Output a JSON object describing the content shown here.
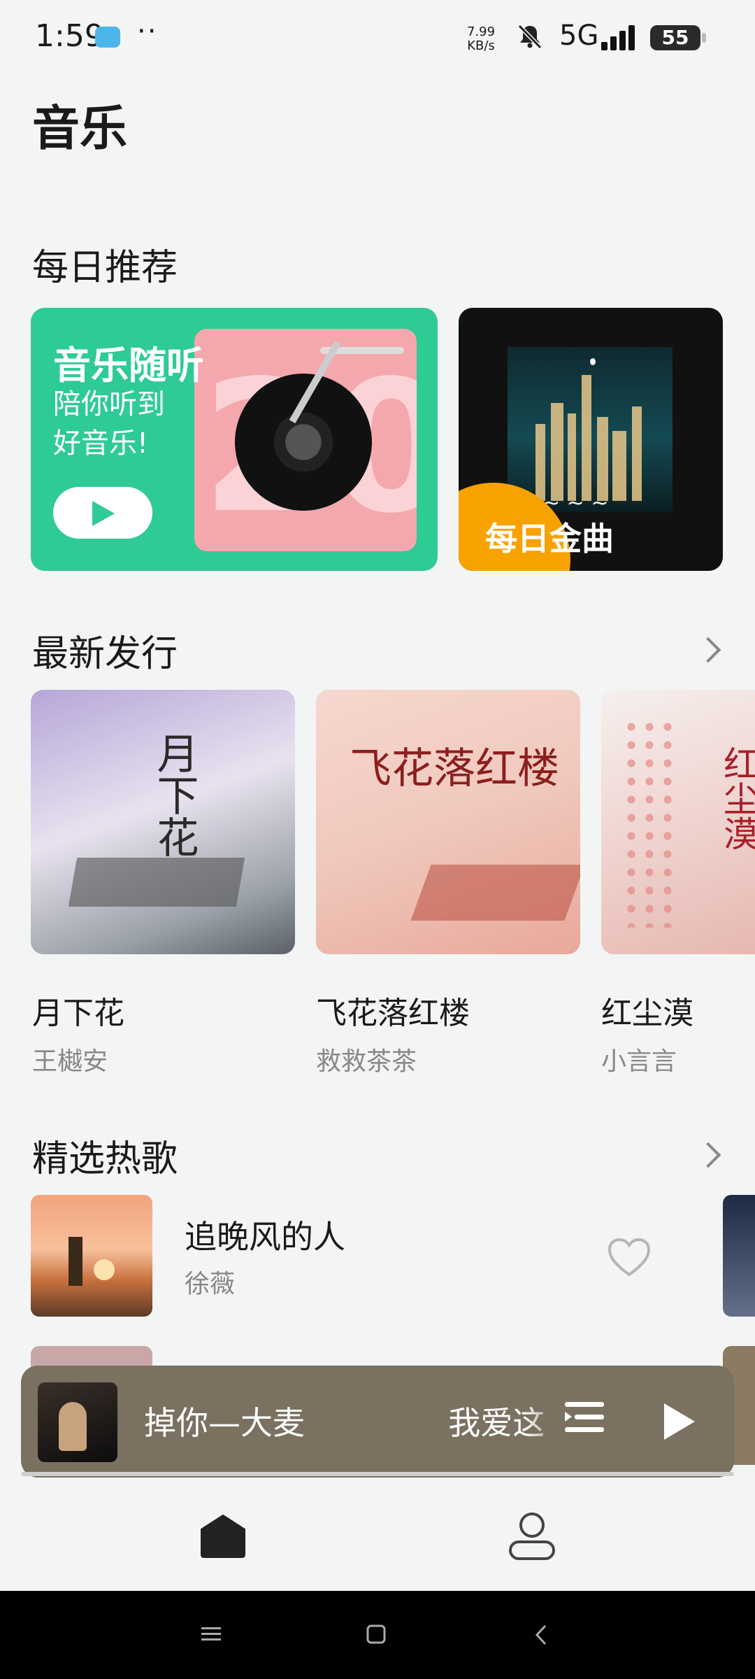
{
  "status_bar": {
    "time": "1:59",
    "dots": "··",
    "speed_value": "7.99",
    "speed_unit": "KB/s",
    "network": "5G",
    "battery": "55"
  },
  "page": {
    "title": "音乐"
  },
  "daily": {
    "title": "每日推荐",
    "card1_title": "音乐随听",
    "card1_line1": "陪你听到",
    "card1_line2": "好音乐!",
    "card1_big": "20",
    "card2_label": "每日金曲"
  },
  "new_releases": {
    "title": "最新发行",
    "items": [
      {
        "title": "月下花",
        "artist": "王樾安",
        "art_text": "月下花"
      },
      {
        "title": "飞花落红楼",
        "artist": "救救茶茶",
        "art_text": "飞花落红楼"
      },
      {
        "title": "红尘漠",
        "artist": "小言言",
        "art_text": "红尘漠"
      }
    ]
  },
  "hot_songs": {
    "title": "精选热歌",
    "items": [
      {
        "title": "追晚风的人",
        "artist": "徐薇"
      }
    ]
  },
  "mini_player": {
    "now_playing": "掉你—大麦",
    "next_text": "我爱这"
  },
  "colors": {
    "accent_green": "#2ecb94",
    "player_bg": "#7a7160",
    "page_bg": "#f2f5f4",
    "orange": "#f7a200"
  },
  "icons": {
    "heart": "heart-icon",
    "list": "playlist-icon",
    "play": "play-icon",
    "home": "home-icon",
    "profile": "profile-icon"
  }
}
